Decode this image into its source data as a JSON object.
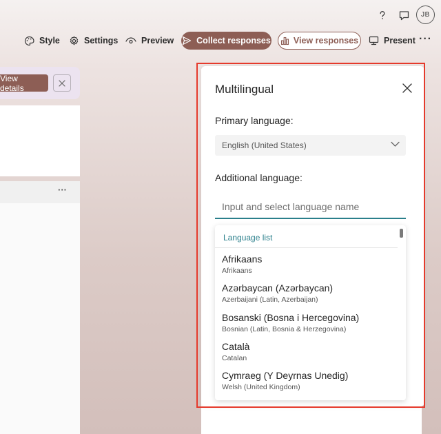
{
  "header": {
    "help_icon": "question-icon",
    "feedback_icon": "comment-icon",
    "avatar_initials": "JB"
  },
  "toolbar": {
    "style_label": "Style",
    "settings_label": "Settings",
    "preview_label": "Preview",
    "collect_label": "Collect responses",
    "view_label": "View responses",
    "present_label": "Present",
    "more_label": "···"
  },
  "notification": {
    "details_label": "View details"
  },
  "panel": {
    "title": "Multilingual",
    "primary_label": "Primary language:",
    "primary_value": "English (United States)",
    "additional_label": "Additional language:",
    "input_placeholder": "Input and select language name",
    "list_header": "Language list",
    "languages": [
      {
        "name": "Afrikaans",
        "sub": "Afrikaans"
      },
      {
        "name": "Azərbaycan (Azərbaycan)",
        "sub": "Azerbaijani (Latin, Azerbaijan)"
      },
      {
        "name": "Bosanski (Bosna i Hercegovina)",
        "sub": "Bosnian (Latin, Bosnia & Herzegovina)"
      },
      {
        "name": "Català",
        "sub": "Catalan"
      },
      {
        "name": "Cymraeg (Y Deyrnas Unedig)",
        "sub": "Welsh (United Kingdom)"
      }
    ]
  },
  "colors": {
    "accent": "#8d5e55",
    "focus": "#2a7f8b",
    "highlight": "#e53a2c"
  }
}
